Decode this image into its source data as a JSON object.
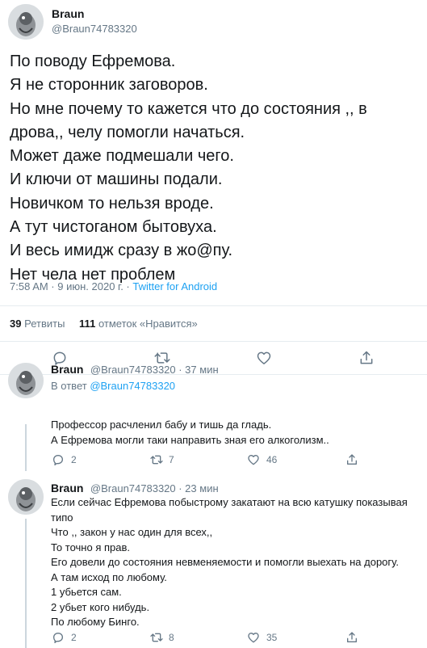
{
  "main_tweet": {
    "author_name": "Braun",
    "author_handle": "@Braun74783320",
    "lines": [
      "По поводу Ефремова.",
      "Я не сторонник заговоров.",
      "Но мне почему то кажется что до состояния ,, в",
      "дрова,, челу помогли начаться.",
      "Может даже подмешали чего.",
      "И ключи от машины подали.",
      "Новичком то нельзя вроде.",
      "А тут чистоганом бытовуха.",
      "И весь имидж сразу в жо@пу.",
      "Нет чела нет проблем"
    ],
    "timestamp": "7:58 AM · 9 июн. 2020 г. · ",
    "source": "Twitter for Android",
    "retweets_count": "39",
    "retweets_label": "Ретвиты",
    "likes_count": "111",
    "likes_label": "отметок «Нравится»"
  },
  "replies": [
    {
      "author_name": "Braun",
      "author_handle": "@Braun74783320 · 37 мин",
      "in_reply_prefix": "В ответ ",
      "in_reply_handle": "@Braun74783320",
      "lines": [
        "Профессор расчленил бабу и тишь да гладь.",
        "А Ефремова могли таки направить зная его алкоголизм.."
      ],
      "reply_count": "2",
      "retweet_count": "7",
      "like_count": "46"
    },
    {
      "author_name": "Braun",
      "author_handle": "@Braun74783320 · 23 мин",
      "lines": [
        "Если сейчас Ефремова побыстрому закатают на всю катушку показывая",
        "типо",
        "Что ,, закон у нас один для всех,,",
        "То точно я прав.",
        "Его довели до состояния невменяемости и помогли выехать на дорогу.",
        "А там исход по любому.",
        "1 убьется сам.",
        "2 убьет кого нибудь.",
        "По любому Бинго."
      ],
      "reply_count": "2",
      "retweet_count": "8",
      "like_count": "35"
    }
  ],
  "colors": {
    "text": "#14171a",
    "secondary": "#657786",
    "link": "#1da1f2",
    "divider": "#e6ecf0"
  },
  "icons": {
    "reply": "reply-icon",
    "retweet": "retweet-icon",
    "like": "heart-icon",
    "share": "share-icon"
  }
}
